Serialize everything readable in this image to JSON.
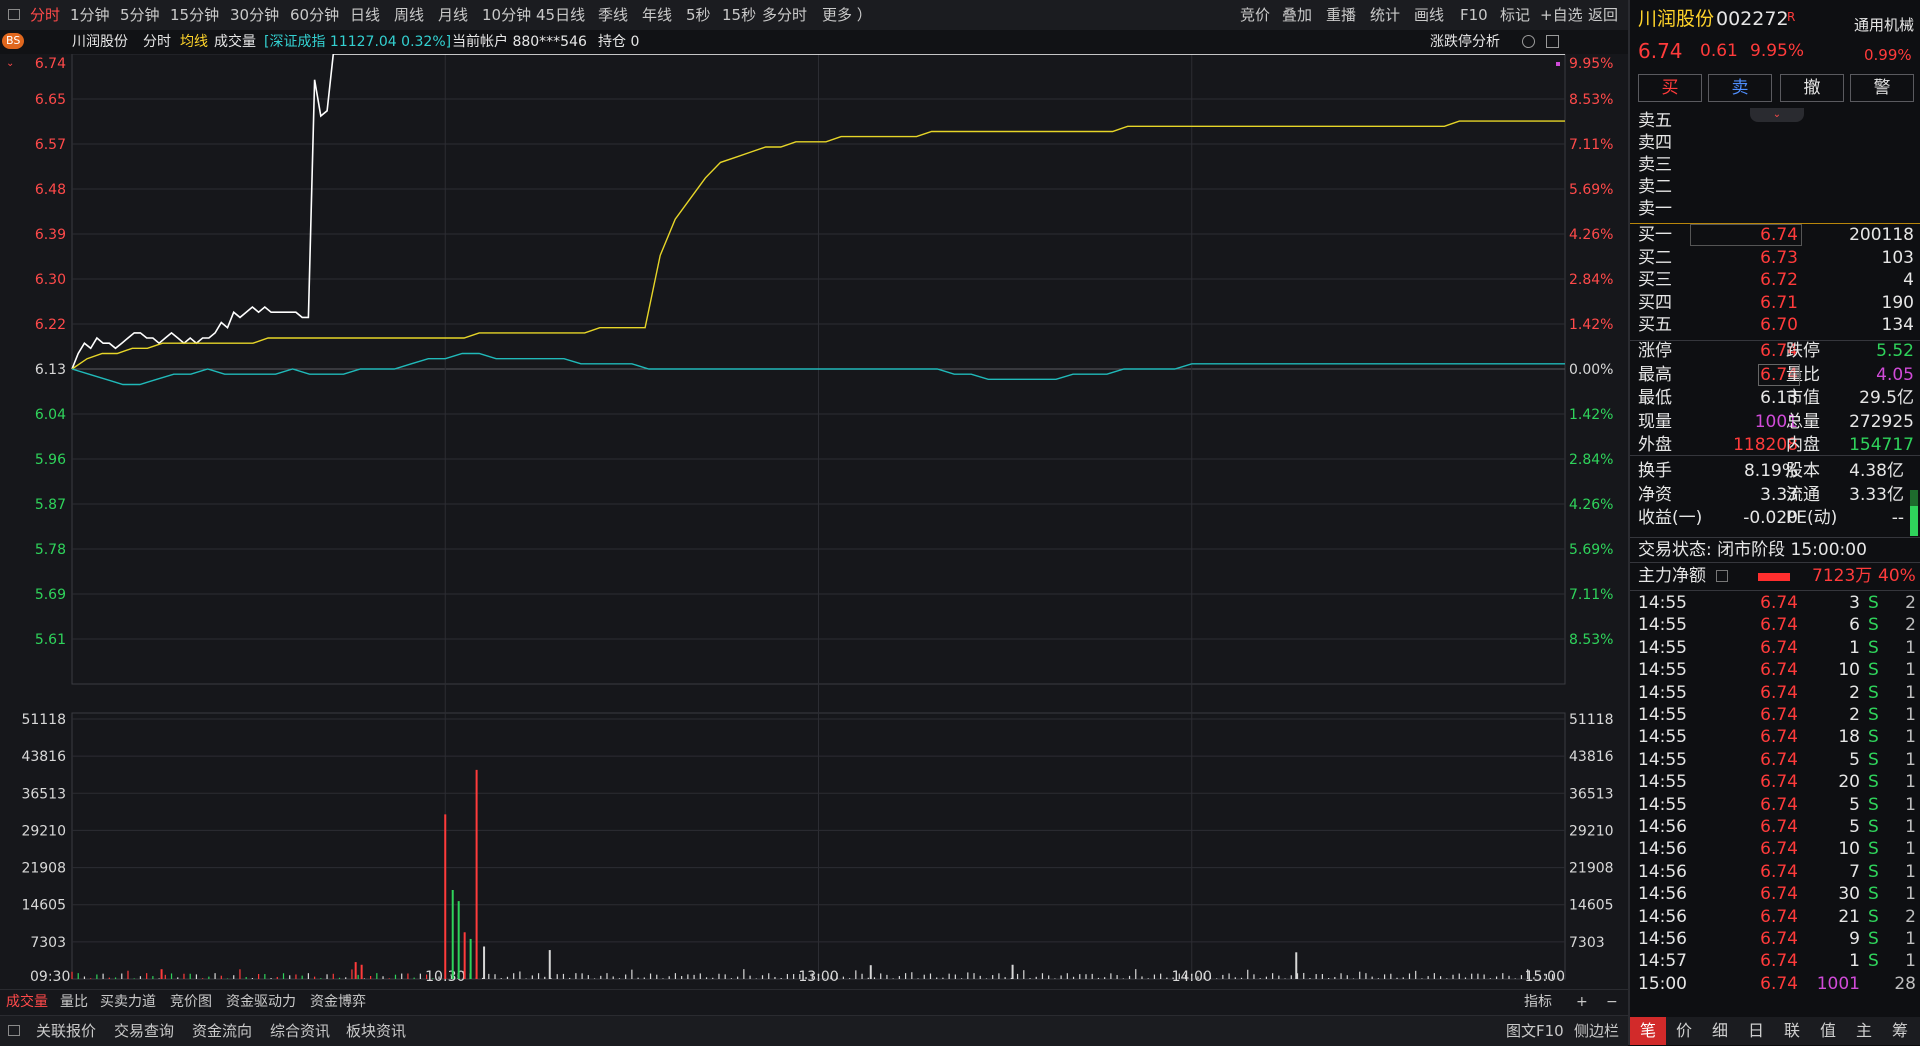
{
  "toolbar": {
    "periods": [
      "分时",
      "1分钟",
      "5分钟",
      "15分钟",
      "30分钟",
      "60分钟",
      "日线",
      "周线",
      "月线",
      "10分钟",
      "45日线",
      "季线",
      "年线",
      "5秒",
      "15秒",
      "多分时",
      "更多 ）"
    ],
    "tools": [
      "竞价",
      "叠加",
      "重播",
      "统计",
      "画线",
      "F10",
      "标记",
      "+自选",
      "返回"
    ]
  },
  "infobar": {
    "name": "川润股份",
    "mode": "分时",
    "avg_label": "均线",
    "vol_label": "成交量",
    "index_text": "[深证成指 11127.04 0.32%]",
    "account": "当前帐户 880***546",
    "position": "持仓 0",
    "analysis": "涨跌停分析",
    "bs_badge": "BS"
  },
  "chart_data": {
    "type": "line",
    "x_ticks": [
      "09:30",
      "10:30",
      "13:00",
      "14:00",
      "15:00"
    ],
    "price_ticks_left": [
      "6.74",
      "6.65",
      "6.57",
      "6.48",
      "6.39",
      "6.30",
      "6.22",
      "6.13",
      "6.04",
      "5.96",
      "5.87",
      "5.78",
      "5.69",
      "5.61"
    ],
    "pct_ticks_right": [
      "9.95%",
      "8.53%",
      "7.11%",
      "5.69%",
      "4.26%",
      "2.84%",
      "1.42%",
      "0.00%",
      "1.42%",
      "2.84%",
      "4.26%",
      "5.69%",
      "7.11%",
      "8.53%"
    ],
    "vol_ticks": [
      "51118",
      "43816",
      "36513",
      "29210",
      "21908",
      "14605",
      "7303"
    ],
    "prev_close": 6.13,
    "ylim": [
      5.52,
      6.74
    ],
    "series": [
      {
        "role": "price",
        "color": "#ffffff",
        "values": [
          6.13,
          6.16,
          6.18,
          6.17,
          6.19,
          6.18,
          6.18,
          6.17,
          6.18,
          6.19,
          6.2,
          6.2,
          6.19,
          6.19,
          6.18,
          6.19,
          6.2,
          6.19,
          6.18,
          6.19,
          6.18,
          6.19,
          6.19,
          6.2,
          6.22,
          6.21,
          6.24,
          6.23,
          6.24,
          6.25,
          6.24,
          6.25,
          6.24,
          6.24,
          6.24,
          6.24,
          6.24,
          6.23,
          6.23,
          6.69,
          6.62,
          6.63,
          6.74,
          6.74
        ]
      },
      {
        "role": "average",
        "color": "#e6d528",
        "values": [
          6.13,
          6.15,
          6.16,
          6.16,
          6.17,
          6.17,
          6.18,
          6.18,
          6.18,
          6.18,
          6.18,
          6.18,
          6.18,
          6.19,
          6.19,
          6.19,
          6.19,
          6.19,
          6.19,
          6.19,
          6.19,
          6.19,
          6.19,
          6.19,
          6.19,
          6.19,
          6.19,
          6.2,
          6.2,
          6.2,
          6.2,
          6.2,
          6.2,
          6.2,
          6.2,
          6.21,
          6.21,
          6.21,
          6.21,
          6.35,
          6.42,
          6.46,
          6.5,
          6.53,
          6.54,
          6.55,
          6.56,
          6.56,
          6.57,
          6.57,
          6.57,
          6.58,
          6.58,
          6.58,
          6.58,
          6.58,
          6.58,
          6.59,
          6.59,
          6.59,
          6.59,
          6.59,
          6.59,
          6.59,
          6.59,
          6.59,
          6.59,
          6.59,
          6.59,
          6.59,
          6.6,
          6.6,
          6.6,
          6.6,
          6.6,
          6.6,
          6.6,
          6.6,
          6.6,
          6.6,
          6.6,
          6.6,
          6.6,
          6.6,
          6.6,
          6.6,
          6.6,
          6.6,
          6.6,
          6.6,
          6.6,
          6.6,
          6.61,
          6.61,
          6.61,
          6.61,
          6.61,
          6.61,
          6.61,
          6.61
        ]
      },
      {
        "role": "index",
        "color": "#20b9b9",
        "values": [
          6.13,
          6.12,
          6.11,
          6.1,
          6.1,
          6.11,
          6.12,
          6.12,
          6.13,
          6.12,
          6.12,
          6.12,
          6.12,
          6.13,
          6.12,
          6.12,
          6.12,
          6.13,
          6.13,
          6.13,
          6.14,
          6.15,
          6.15,
          6.16,
          6.16,
          6.15,
          6.15,
          6.15,
          6.15,
          6.15,
          6.14,
          6.14,
          6.14,
          6.14,
          6.13,
          6.13,
          6.13,
          6.13,
          6.13,
          6.13,
          6.13,
          6.13,
          6.13,
          6.13,
          6.13,
          6.13,
          6.13,
          6.13,
          6.13,
          6.13,
          6.13,
          6.13,
          6.12,
          6.12,
          6.11,
          6.11,
          6.11,
          6.11,
          6.11,
          6.12,
          6.12,
          6.12,
          6.13,
          6.13,
          6.13,
          6.13,
          6.14,
          6.14,
          6.14,
          6.14,
          6.14,
          6.14,
          6.14,
          6.14,
          6.14,
          6.14,
          6.14,
          6.14,
          6.14,
          6.14,
          6.14,
          6.14,
          6.14,
          6.14,
          6.14,
          6.14,
          6.14,
          6.14,
          6.14
        ]
      }
    ],
    "volume_bars": [
      {
        "x": 0.25,
        "v": 37000,
        "c": "red"
      },
      {
        "x": 0.255,
        "v": 20000,
        "c": "green"
      },
      {
        "x": 0.259,
        "v": 17500,
        "c": "green"
      },
      {
        "x": 0.263,
        "v": 10500,
        "c": "red"
      },
      {
        "x": 0.267,
        "v": 9000,
        "c": "green"
      },
      {
        "x": 0.271,
        "v": 47000,
        "c": "red"
      },
      {
        "x": 0.276,
        "v": 7300,
        "c": "white"
      },
      {
        "x": 0.63,
        "v": 3200,
        "c": "white"
      },
      {
        "x": 0.535,
        "v": 3100,
        "c": "white"
      },
      {
        "x": 0.32,
        "v": 6500,
        "c": "white"
      },
      {
        "x": 0.19,
        "v": 3800,
        "c": "red"
      },
      {
        "x": 0.194,
        "v": 3200,
        "c": "red"
      },
      {
        "x": 0.06,
        "v": 2200,
        "c": "red"
      },
      {
        "x": 0.82,
        "v": 6000,
        "c": "white"
      }
    ]
  },
  "bottom_tabs": [
    "成交量",
    "量比",
    "买卖力道",
    "竞价图",
    "资金驱动力",
    "资金博弈"
  ],
  "bottom_right": [
    "指标",
    "+",
    "−"
  ],
  "status_items": [
    "关联报价",
    "交易查询",
    "资金流向",
    "综合资讯",
    "板块资讯"
  ],
  "status_right": [
    "图文F10",
    "侧边栏"
  ],
  "quote": {
    "name": "川润股份",
    "code": "002272",
    "flag": "R",
    "sector": "通用机械",
    "sector_pct": "0.99%",
    "price": "6.74",
    "change": "0.61",
    "pct": "9.95%",
    "buttons": [
      "买",
      "卖",
      "撤",
      "警"
    ],
    "asks": [
      {
        "label": "卖五",
        "price": "",
        "vol": ""
      },
      {
        "label": "卖四",
        "price": "",
        "vol": ""
      },
      {
        "label": "卖三",
        "price": "",
        "vol": ""
      },
      {
        "label": "卖二",
        "price": "",
        "vol": ""
      },
      {
        "label": "卖一",
        "price": "",
        "vol": ""
      }
    ],
    "bids": [
      {
        "label": "买一",
        "price": "6.74",
        "vol": "200118"
      },
      {
        "label": "买二",
        "price": "6.73",
        "vol": "103"
      },
      {
        "label": "买三",
        "price": "6.72",
        "vol": "4"
      },
      {
        "label": "买四",
        "price": "6.71",
        "vol": "190"
      },
      {
        "label": "买五",
        "price": "6.70",
        "vol": "134"
      }
    ],
    "stats": [
      {
        "l1": "涨停",
        "v1": "6.74",
        "c1": "red",
        "l2": "跌停",
        "v2": "5.52",
        "c2": "green"
      },
      {
        "l1": "最高",
        "v1": "6.74",
        "c1": "red",
        "l2": "量比",
        "v2": "4.05",
        "c2": "purple"
      },
      {
        "l1": "最低",
        "v1": "6.13",
        "c1": "white",
        "l2": "市值",
        "v2": "29.5亿",
        "c2": "white"
      },
      {
        "l1": "现量",
        "v1": "1001",
        "c1": "purple",
        "l2": "总量",
        "v2": "272925",
        "c2": "white"
      },
      {
        "l1": "外盘",
        "v1": "118208",
        "c1": "red",
        "l2": "内盘",
        "v2": "154717",
        "c2": "green"
      }
    ],
    "stats2": [
      {
        "l1": "换手",
        "v1": "8.19%",
        "l2": "股本",
        "v2": "4.38亿"
      },
      {
        "l1": "净资",
        "v1": "3.33",
        "l2": "流通",
        "v2": "3.33亿"
      },
      {
        "l1": "收益(一)",
        "v1": "-0.020",
        "l2": "PE(动)",
        "v2": "--"
      }
    ],
    "trade_status": "交易状态: 闭市阶段 15:00:00",
    "main_net_label": "主力净额",
    "main_net_value": "7123万",
    "main_net_pct": "40%",
    "ticks": [
      {
        "t": "14:55",
        "p": "6.74",
        "v": "3",
        "s": "S",
        "n": "2"
      },
      {
        "t": "14:55",
        "p": "6.74",
        "v": "6",
        "s": "S",
        "n": "2"
      },
      {
        "t": "14:55",
        "p": "6.74",
        "v": "1",
        "s": "S",
        "n": "1"
      },
      {
        "t": "14:55",
        "p": "6.74",
        "v": "10",
        "s": "S",
        "n": "1"
      },
      {
        "t": "14:55",
        "p": "6.74",
        "v": "2",
        "s": "S",
        "n": "1"
      },
      {
        "t": "14:55",
        "p": "6.74",
        "v": "2",
        "s": "S",
        "n": "1"
      },
      {
        "t": "14:55",
        "p": "6.74",
        "v": "18",
        "s": "S",
        "n": "1"
      },
      {
        "t": "14:55",
        "p": "6.74",
        "v": "5",
        "s": "S",
        "n": "1"
      },
      {
        "t": "14:55",
        "p": "6.74",
        "v": "20",
        "s": "S",
        "n": "1"
      },
      {
        "t": "14:55",
        "p": "6.74",
        "v": "5",
        "s": "S",
        "n": "1"
      },
      {
        "t": "14:56",
        "p": "6.74",
        "v": "5",
        "s": "S",
        "n": "1"
      },
      {
        "t": "14:56",
        "p": "6.74",
        "v": "10",
        "s": "S",
        "n": "1"
      },
      {
        "t": "14:56",
        "p": "6.74",
        "v": "7",
        "s": "S",
        "n": "1"
      },
      {
        "t": "14:56",
        "p": "6.74",
        "v": "30",
        "s": "S",
        "n": "1"
      },
      {
        "t": "14:56",
        "p": "6.74",
        "v": "21",
        "s": "S",
        "n": "2"
      },
      {
        "t": "14:56",
        "p": "6.74",
        "v": "9",
        "s": "S",
        "n": "1"
      },
      {
        "t": "14:57",
        "p": "6.74",
        "v": "1",
        "s": "S",
        "n": "1"
      },
      {
        "t": "15:00",
        "p": "6.74",
        "v": "1001",
        "s": "",
        "n": "28"
      }
    ],
    "footer_tabs": [
      "笔",
      "价",
      "细",
      "日",
      "联",
      "值",
      "主",
      "筹"
    ]
  }
}
